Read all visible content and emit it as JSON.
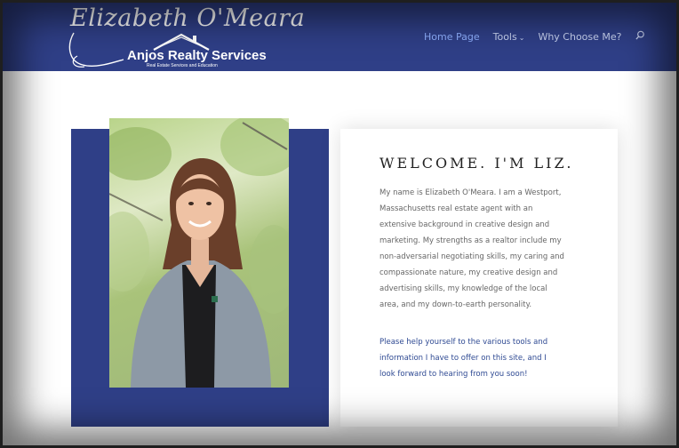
{
  "logo": {
    "script_name": "Elizabeth O'Meara",
    "company": "Anjos Realty Services",
    "tagline": "Real Estate Services and Education"
  },
  "nav": {
    "items": [
      {
        "label": "Home Page"
      },
      {
        "label": "Tools"
      },
      {
        "label": "Why Choose Me?"
      }
    ]
  },
  "welcome": {
    "title": "WELCOME. I'M LIZ.",
    "bio": "My name is Elizabeth O'Meara. I am a Westport, Massachusetts real estate agent with an extensive background in creative design and marketing. My strengths as a realtor include my non-adversarial negotiating skills, my caring and compassionate nature, my creative design and advertising skills, my knowledge of the local area, and my down-to-earth personality.",
    "invite": "Please help yourself to the various tools and information I have to offer on this site, and I look forward to hearing from you soon!"
  },
  "colors": {
    "brand_blue": "#2f3f87",
    "nav_active": "#8fb0ff",
    "link_text": "#2f4a93"
  }
}
